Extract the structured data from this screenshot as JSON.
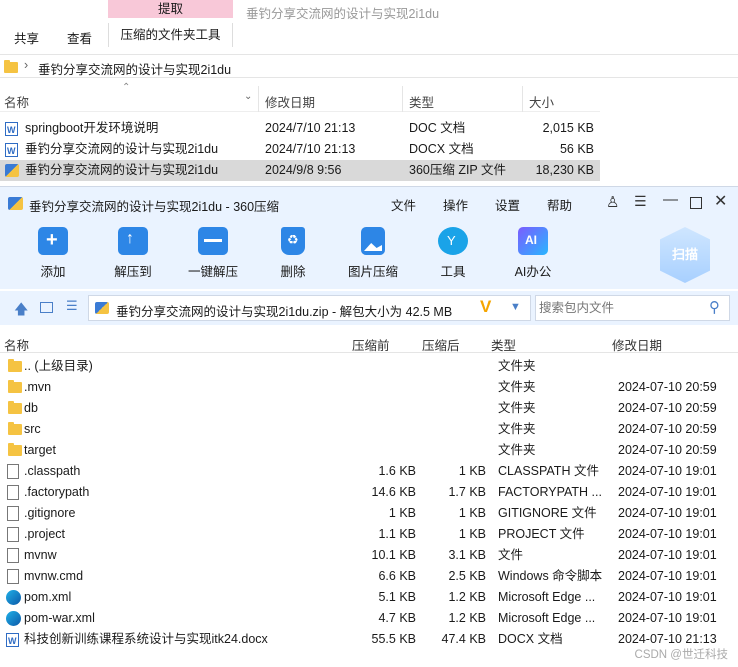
{
  "explorer": {
    "ribbon": {
      "extract": "提取",
      "share": "共享",
      "view": "查看",
      "compressed_tools": "压缩的文件夹工具"
    },
    "title": "垂钓分享交流网的设计与实现2i1du",
    "address": "垂钓分享交流网的设计与实现2i1du",
    "columns": {
      "name": "名称",
      "modified": "修改日期",
      "type": "类型",
      "size": "大小"
    },
    "files": [
      {
        "name": "springboot开发环境说明",
        "date": "2024/7/10 21:13",
        "type": "DOC 文档",
        "size": "2,015 KB"
      },
      {
        "name": "垂钓分享交流网的设计与实现2i1du",
        "date": "2024/7/10 21:13",
        "type": "DOCX 文档",
        "size": "56 KB"
      },
      {
        "name": "垂钓分享交流网的设计与实现2i1du",
        "date": "2024/9/8 9:56",
        "type": "360压缩 ZIP 文件",
        "size": "18,230 KB"
      }
    ]
  },
  "app": {
    "title": "垂钓分享交流网的设计与实现2i1du - 360压缩",
    "menu": [
      "文件",
      "操作",
      "设置",
      "帮助"
    ],
    "toolbar": [
      "添加",
      "解压到",
      "一键解压",
      "删除",
      "图片压缩",
      "工具",
      "AI办公"
    ],
    "scan": "扫描",
    "path": "垂钓分享交流网的设计与实现2i1du.zip - 解包大小为 42.5 MB",
    "search_placeholder": "搜索包内文件",
    "columns": {
      "name": "名称",
      "before": "压缩前",
      "after": "压缩后",
      "type": "类型",
      "modified": "修改日期"
    },
    "rows": [
      {
        "name": ".. (上级目录)",
        "before": "",
        "after": "",
        "type": "文件夹",
        "date": "",
        "icon": "folder"
      },
      {
        "name": ".mvn",
        "before": "",
        "after": "",
        "type": "文件夹",
        "date": "2024-07-10 20:59",
        "icon": "folder"
      },
      {
        "name": "db",
        "before": "",
        "after": "",
        "type": "文件夹",
        "date": "2024-07-10 20:59",
        "icon": "folder"
      },
      {
        "name": "src",
        "before": "",
        "after": "",
        "type": "文件夹",
        "date": "2024-07-10 20:59",
        "icon": "folder"
      },
      {
        "name": "target",
        "before": "",
        "after": "",
        "type": "文件夹",
        "date": "2024-07-10 20:59",
        "icon": "folder"
      },
      {
        "name": ".classpath",
        "before": "1.6 KB",
        "after": "1 KB",
        "type": "CLASSPATH 文件",
        "date": "2024-07-10 19:01",
        "icon": "doc"
      },
      {
        "name": ".factorypath",
        "before": "14.6 KB",
        "after": "1.7 KB",
        "type": "FACTORYPATH ...",
        "date": "2024-07-10 19:01",
        "icon": "doc"
      },
      {
        "name": ".gitignore",
        "before": "1 KB",
        "after": "1 KB",
        "type": "GITIGNORE 文件",
        "date": "2024-07-10 19:01",
        "icon": "doc"
      },
      {
        "name": ".project",
        "before": "1.1 KB",
        "after": "1 KB",
        "type": "PROJECT 文件",
        "date": "2024-07-10 19:01",
        "icon": "doc"
      },
      {
        "name": "mvnw",
        "before": "10.1 KB",
        "after": "3.1 KB",
        "type": "文件",
        "date": "2024-07-10 19:01",
        "icon": "doc"
      },
      {
        "name": "mvnw.cmd",
        "before": "6.6 KB",
        "after": "2.5 KB",
        "type": "Windows 命令脚本",
        "date": "2024-07-10 19:01",
        "icon": "doc"
      },
      {
        "name": "pom.xml",
        "before": "5.1 KB",
        "after": "1.2 KB",
        "type": "Microsoft Edge ...",
        "date": "2024-07-10 19:01",
        "icon": "edge"
      },
      {
        "name": "pom-war.xml",
        "before": "4.7 KB",
        "after": "1.2 KB",
        "type": "Microsoft Edge ...",
        "date": "2024-07-10 19:01",
        "icon": "edge"
      },
      {
        "name": "科技创新训练课程系统设计与实现itk24.docx",
        "before": "55.5 KB",
        "after": "47.4 KB",
        "type": "DOCX 文档",
        "date": "2024-07-10 21:13",
        "icon": "word"
      }
    ]
  },
  "watermark": "CSDN @世迁科技"
}
